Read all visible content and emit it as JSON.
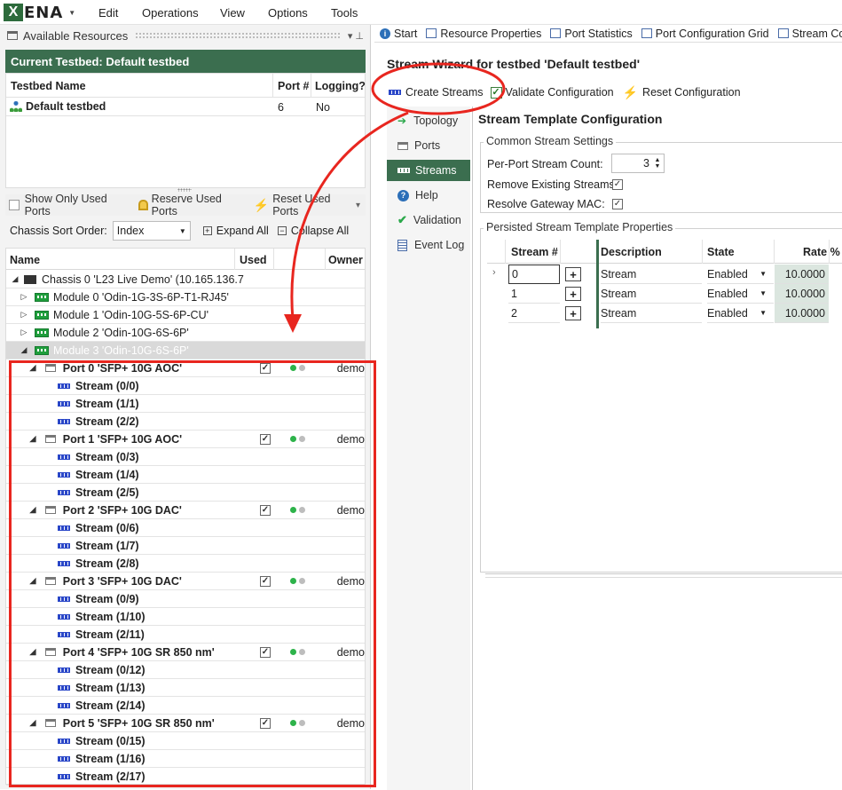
{
  "app": {
    "logo_text": "ENA",
    "logo_mark": "X",
    "logo_caret": "▼"
  },
  "menu": [
    "Edit",
    "Operations",
    "View",
    "Options",
    "Tools"
  ],
  "left": {
    "panel_title": "Available Resources",
    "pin_symbols": "▾ ⊥",
    "current_testbed": "Current Testbed: Default testbed",
    "testbed_cols": {
      "name": "Testbed Name",
      "ports": "Port #",
      "logging": "Logging?"
    },
    "testbed_row": {
      "name": "Default testbed",
      "ports": "6",
      "logging": "No"
    },
    "toolbar": {
      "show_only_used": "Show Only Used Ports",
      "reserve": "Reserve Used Ports",
      "reset": "Reset Used Ports"
    },
    "sort_label": "Chassis Sort Order:",
    "sort_value": "Index",
    "expand_all": "Expand All",
    "collapse_all": "Collapse All",
    "tree_cols": {
      "name": "Name",
      "used": "Used",
      "owner": "Owner"
    },
    "chassis": "Chassis 0 'L23 Live Demo' (10.165.136.7",
    "modules": [
      "Module 0 'Odin-1G-3S-6P-T1-RJ45'",
      "Module 1 'Odin-10G-5S-6P-CU'",
      "Module 2 'Odin-10G-6S-6P'",
      "Module 3 'Odin-10G-6S-6P'"
    ],
    "ports": [
      {
        "name": "Port 0 'SFP+ 10G AOC'",
        "owner": "demo",
        "streams": [
          "Stream (0/0)",
          "Stream (1/1)",
          "Stream (2/2)"
        ]
      },
      {
        "name": "Port 1 'SFP+ 10G AOC'",
        "owner": "demo",
        "streams": [
          "Stream (0/3)",
          "Stream (1/4)",
          "Stream (2/5)"
        ]
      },
      {
        "name": "Port 2 'SFP+ 10G DAC'",
        "owner": "demo",
        "streams": [
          "Stream (0/6)",
          "Stream (1/7)",
          "Stream (2/8)"
        ]
      },
      {
        "name": "Port 3 'SFP+ 10G DAC'",
        "owner": "demo",
        "streams": [
          "Stream (0/9)",
          "Stream (1/10)",
          "Stream (2/11)"
        ]
      },
      {
        "name": "Port 4 'SFP+ 10G SR 850 nm'",
        "owner": "demo",
        "streams": [
          "Stream (0/12)",
          "Stream (1/13)",
          "Stream (2/14)"
        ]
      },
      {
        "name": "Port 5 'SFP+ 10G SR 850 nm'",
        "owner": "demo",
        "streams": [
          "Stream (0/15)",
          "Stream (1/16)",
          "Stream (2/17)"
        ]
      }
    ],
    "check_mark": "✓"
  },
  "right": {
    "tabs": [
      "Start",
      "Resource Properties",
      "Port Statistics",
      "Port Configuration Grid",
      "Stream Conf"
    ],
    "wizard_title": "Stream Wizard for testbed 'Default testbed'",
    "toolbar": {
      "create": "Create Streams",
      "validate": "Validate Configuration",
      "reset": "Reset Configuration"
    },
    "nav": [
      "Topology",
      "Ports",
      "Streams",
      "Help",
      "Validation",
      "Event Log"
    ],
    "template_title": "Stream Template Configuration",
    "common_group": "Common Stream Settings",
    "per_port_label": "Per-Port Stream Count:",
    "per_port_value": "3",
    "remove_label": "Remove Existing Streams:",
    "resolve_label": "Resolve Gateway MAC:",
    "persisted_group": "Persisted Stream Template Properties",
    "table_cols": {
      "stream": "Stream #",
      "desc": "Description",
      "state": "State",
      "rate": "Rate %"
    },
    "table_rows": [
      {
        "stream": "0",
        "desc": "Stream",
        "state": "Enabled",
        "rate": "10.0000"
      },
      {
        "stream": "1",
        "desc": "Stream",
        "state": "Enabled",
        "rate": "10.0000"
      },
      {
        "stream": "2",
        "desc": "Stream",
        "state": "Enabled",
        "rate": "10.0000"
      }
    ]
  },
  "colors": {
    "accent_green": "#3b6e4f",
    "annotation_red": "#e8261f",
    "dot_green": "#2db34a",
    "dot_grey": "#bdbdbd"
  }
}
